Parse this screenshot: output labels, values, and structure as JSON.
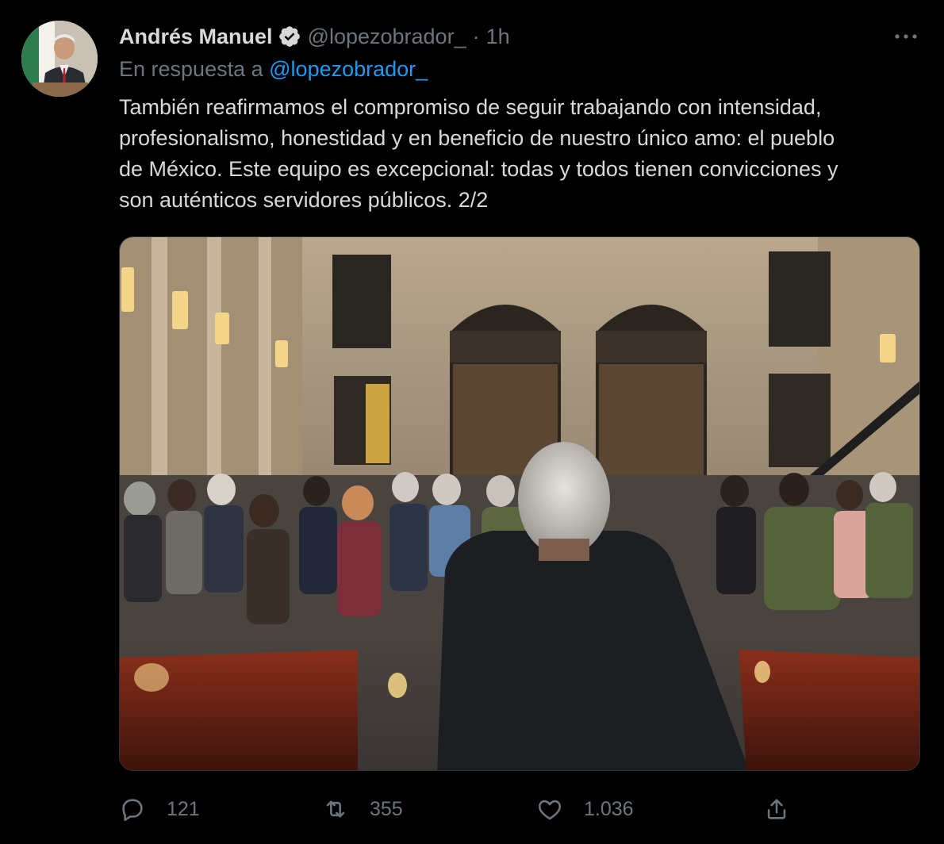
{
  "tweet": {
    "display_name": "Andrés Manuel",
    "handle": "@lopezobrador_",
    "separator": "·",
    "time": "1h",
    "reply_prefix": "En respuesta a",
    "reply_handle": "@lopezobrador_",
    "text_lines": [
      "También reafirmamos el compromiso de seguir trabajando con intensidad,",
      "profesionalismo, honestidad y en beneficio de nuestro único amo: el pueblo",
      "de México. Este equipo es excepcional: todas y todos tienen convicciones y",
      "son auténticos servidores públicos. 2/2"
    ]
  },
  "actions": {
    "reply_count": "121",
    "retweet_count": "355",
    "like_count": "1.036"
  },
  "icons": {
    "verified": "verified-badge-icon",
    "more": "more-options-icon",
    "reply": "reply-icon",
    "retweet": "retweet-icon",
    "like": "like-icon",
    "share": "share-icon"
  },
  "colors": {
    "background": "#000000",
    "text": "#d9d9d9",
    "muted": "#6e767d",
    "link": "#1d9bf0"
  }
}
